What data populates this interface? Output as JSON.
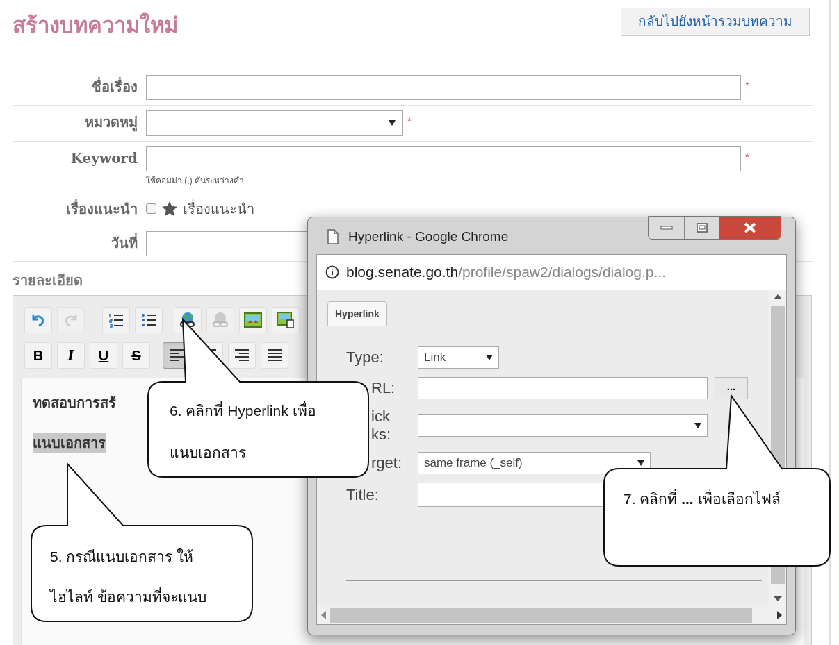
{
  "page": {
    "title": "สร้างบทความใหม่",
    "back_button": "กลับไปยังหน้ารวมบทความ"
  },
  "form": {
    "required_mark": "*",
    "fields": [
      {
        "kind": "text",
        "label": "ชื่อเรื่อง",
        "required": true
      },
      {
        "kind": "select",
        "label": "หมวดหมู่",
        "required": true
      },
      {
        "kind": "text",
        "label": "Keyword",
        "required": true,
        "hint": "ใช้คอมม่า (,) คั่นระหว่างคำ"
      },
      {
        "kind": "checkbox",
        "label": "เรื่องแนะนำ",
        "option": "เรื่องแนะนำ",
        "checked": false
      },
      {
        "kind": "date",
        "label": "วันที่"
      }
    ]
  },
  "editor": {
    "label": "รายละเอียด",
    "toolbar": [
      [
        {
          "kind": "undo",
          "disabled": false
        },
        {
          "kind": "redo",
          "disabled": true
        },
        {
          "kind": "ordered-list",
          "disabled": false
        },
        {
          "kind": "bullet-list",
          "disabled": false
        },
        {
          "kind": "link",
          "disabled": false
        },
        {
          "kind": "unlink",
          "disabled": true
        },
        {
          "kind": "image",
          "disabled": false
        },
        {
          "kind": "image-properties",
          "disabled": false
        }
      ],
      [
        {
          "kind": "text",
          "label": "B",
          "selected": false
        },
        {
          "kind": "text",
          "label": "I",
          "selected": false
        },
        {
          "kind": "text",
          "label": "U",
          "selected": false
        },
        {
          "kind": "text",
          "label": "S",
          "selected": false
        },
        {
          "kind": "align-left",
          "selected": true
        },
        {
          "kind": "align-center",
          "selected": false
        },
        {
          "kind": "align-right",
          "selected": false
        },
        {
          "kind": "justify",
          "selected": false
        }
      ]
    ],
    "paragraphs": [
      {
        "text": "ทดสอบการสร้",
        "highlighted": false
      },
      {
        "text": "แนบเอกสาร",
        "highlighted": true
      }
    ]
  },
  "dialog": {
    "title": "Hyperlink - Google Chrome",
    "url_host": "blog.senate.go.th",
    "url_path": "/profile/spaw2/dialogs/dialog.p...",
    "tabs": [
      {
        "label": "Hyperlink",
        "selected": true
      }
    ],
    "fields": [
      {
        "kind": "select",
        "label": "Type:",
        "cut": false,
        "value": "Link"
      },
      {
        "kind": "input-button",
        "label": "RL:",
        "cut": true,
        "button": "..."
      },
      {
        "kind": "select",
        "label": "ick\nks:",
        "cut": true
      },
      {
        "kind": "select",
        "label": "rget:",
        "cut": true,
        "value": "same frame (_self)"
      },
      {
        "kind": "input",
        "label": "Title:",
        "cut": false
      }
    ]
  },
  "callouts": [
    {
      "lines": [
        "6. คลิกที่ Hyperlink เพื่อ",
        "แนบเอกสาร"
      ]
    },
    {
      "lines": [
        "5. กรณีแนบเอกสาร ให้",
        "ไฮไลท์ ข้อความที่จะแนบ"
      ]
    },
    {
      "lines": [
        "7. คลิกที่ **...** เพื่อเลือกไฟล์"
      ]
    }
  ]
}
